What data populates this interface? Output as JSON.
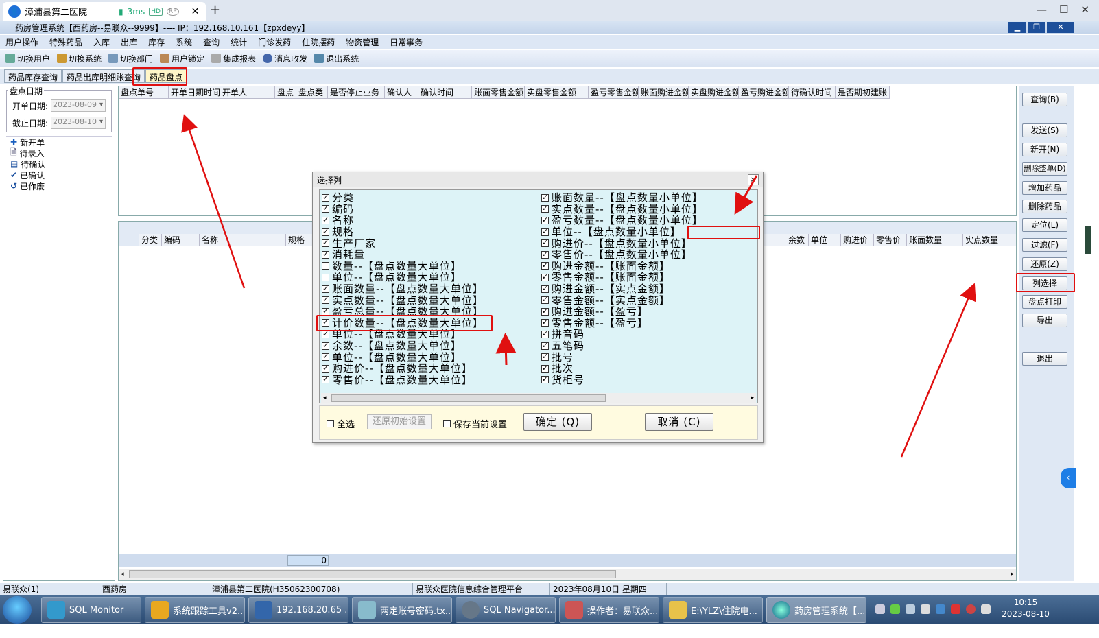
{
  "remote_tab": {
    "title": "漳浦县第二医院",
    "latency": "3ms",
    "badge1": "HD",
    "badge2": "RP",
    "new_tab": "+"
  },
  "window": {
    "title": "药房管理系统【西药房--易联众--9999】---- IP：192.168.10.161【zpxdeyy】"
  },
  "menu": [
    "用户操作",
    "特殊药品",
    "入库",
    "出库",
    "库存",
    "系统",
    "查询",
    "统计",
    "门诊发药",
    "住院摆药",
    "物资管理",
    "日常事务"
  ],
  "toolbar": [
    "切换用户",
    "切换系统",
    "切换部门",
    "用户锁定",
    "集成报表",
    "消息收发",
    "退出系统"
  ],
  "doc_tabs": [
    "药品库存查询",
    "药品出库明细账查询",
    "药品盘点"
  ],
  "left": {
    "group_title": "盘点日期",
    "start_label": "开单日期:",
    "start_value": "2023-08-09",
    "end_label": "截止日期:",
    "end_value": "2023-08-10",
    "tree": [
      "新开单",
      "待录入",
      "待确认",
      "已确认",
      "已作废"
    ]
  },
  "grid1_headers": [
    "盘点单号",
    "开单日期时间",
    "开单人",
    "盘点",
    "盘点类",
    "是否停止业务",
    "确认人",
    "确认时间",
    "账面零售金额",
    "实盘零售金额",
    "盈亏零售金额",
    "账面购进金额",
    "实盘购进金额",
    "盈亏购进金额",
    "待确认时间",
    "是否期初建账"
  ],
  "grid2_headers_left": [
    "分类",
    "编码",
    "名称",
    "规格"
  ],
  "grid2_headers_right": [
    "余数",
    "单位",
    "购进价",
    "零售价",
    "账面数量",
    "实点数量"
  ],
  "grid2_footer_value": "0",
  "right_buttons": [
    "查询(B)",
    "发送(S)",
    "新开(N)",
    "删除整单(D)",
    "增加药品",
    "删除药品",
    "定位(L)",
    "过滤(F)",
    "还原(Z)",
    "列选择",
    "盘点打印",
    "导出",
    "退出"
  ],
  "dialog": {
    "title": "选择列",
    "close": "×",
    "left_items": [
      {
        "label": "分类",
        "checked": true
      },
      {
        "label": "编码",
        "checked": true
      },
      {
        "label": "名称",
        "checked": true
      },
      {
        "label": "规格",
        "checked": true
      },
      {
        "label": "生产厂家",
        "checked": true
      },
      {
        "label": "消耗量",
        "checked": true
      },
      {
        "label": "数量--【盘点数量大单位】",
        "checked": false
      },
      {
        "label": "单位--【盘点数量大单位】",
        "checked": false
      },
      {
        "label": "账面数量--【盘点数量大单位】",
        "checked": true
      },
      {
        "label": "实点数量--【盘点数量大单位】",
        "checked": true
      },
      {
        "label": "盈亏总量--【盘点数量大单位】",
        "checked": true
      },
      {
        "label": "计价数量--【盘点数量大单位】",
        "checked": true
      },
      {
        "label": "单位--【盘点数量大单位】",
        "checked": true
      },
      {
        "label": "余数--【盘点数量大单位】",
        "checked": true
      },
      {
        "label": "单位--【盘点数量大单位】",
        "checked": true
      },
      {
        "label": "购进价--【盘点数量大单位】",
        "checked": true
      },
      {
        "label": "零售价--【盘点数量大单位】",
        "checked": true
      }
    ],
    "right_items": [
      {
        "label": "账面数量--【盘点数量小单位】",
        "checked": true
      },
      {
        "label": "实点数量--【盘点数量小单位】",
        "checked": true
      },
      {
        "label": "盈亏数量--【盘点数量小单位】",
        "checked": true
      },
      {
        "label": "单位--【盘点数量小单位】",
        "checked": true
      },
      {
        "label": "购进价--【盘点数量小单位】",
        "checked": true
      },
      {
        "label": "零售价--【盘点数量小单位】",
        "checked": true
      },
      {
        "label": "购进金额--【账面金额】",
        "checked": true
      },
      {
        "label": "零售金额--【账面金额】",
        "checked": true
      },
      {
        "label": "购进金额--【实点金额】",
        "checked": true
      },
      {
        "label": "零售金额--【实点金额】",
        "checked": true
      },
      {
        "label": "购进金额--【盈亏】",
        "checked": true
      },
      {
        "label": "零售金额--【盈亏】",
        "checked": true
      },
      {
        "label": "拼音码",
        "checked": true
      },
      {
        "label": "五笔码",
        "checked": true
      },
      {
        "label": "批号",
        "checked": true
      },
      {
        "label": "批次",
        "checked": true
      },
      {
        "label": "货柜号",
        "checked": true
      }
    ],
    "select_all": "全选",
    "restore": "还原初始设置",
    "save": "保存当前设置",
    "ok": "确定 (Q)",
    "cancel": "取消 (C)"
  },
  "status": [
    "易联众(1)",
    "西药房",
    "漳浦县第二医院(H35062300708)",
    "易联众医院信息综合管理平台",
    "2023年08月10日 星期四"
  ],
  "taskbar": [
    "SQL Monitor",
    "系统跟踪工具v2...",
    "192.168.20.65 ...",
    "两定账号密码.tx...",
    "SQL Navigator...",
    "操作者：易联众...",
    "E:\\YLZ\\住院电...",
    "药房管理系统【..."
  ],
  "clock": {
    "time": "10:15",
    "date": "2023-08-10"
  },
  "colors": {
    "accent": "#1e6fd9",
    "annotation": "#e01010",
    "dialog_list_bg": "#ddf3f7"
  }
}
